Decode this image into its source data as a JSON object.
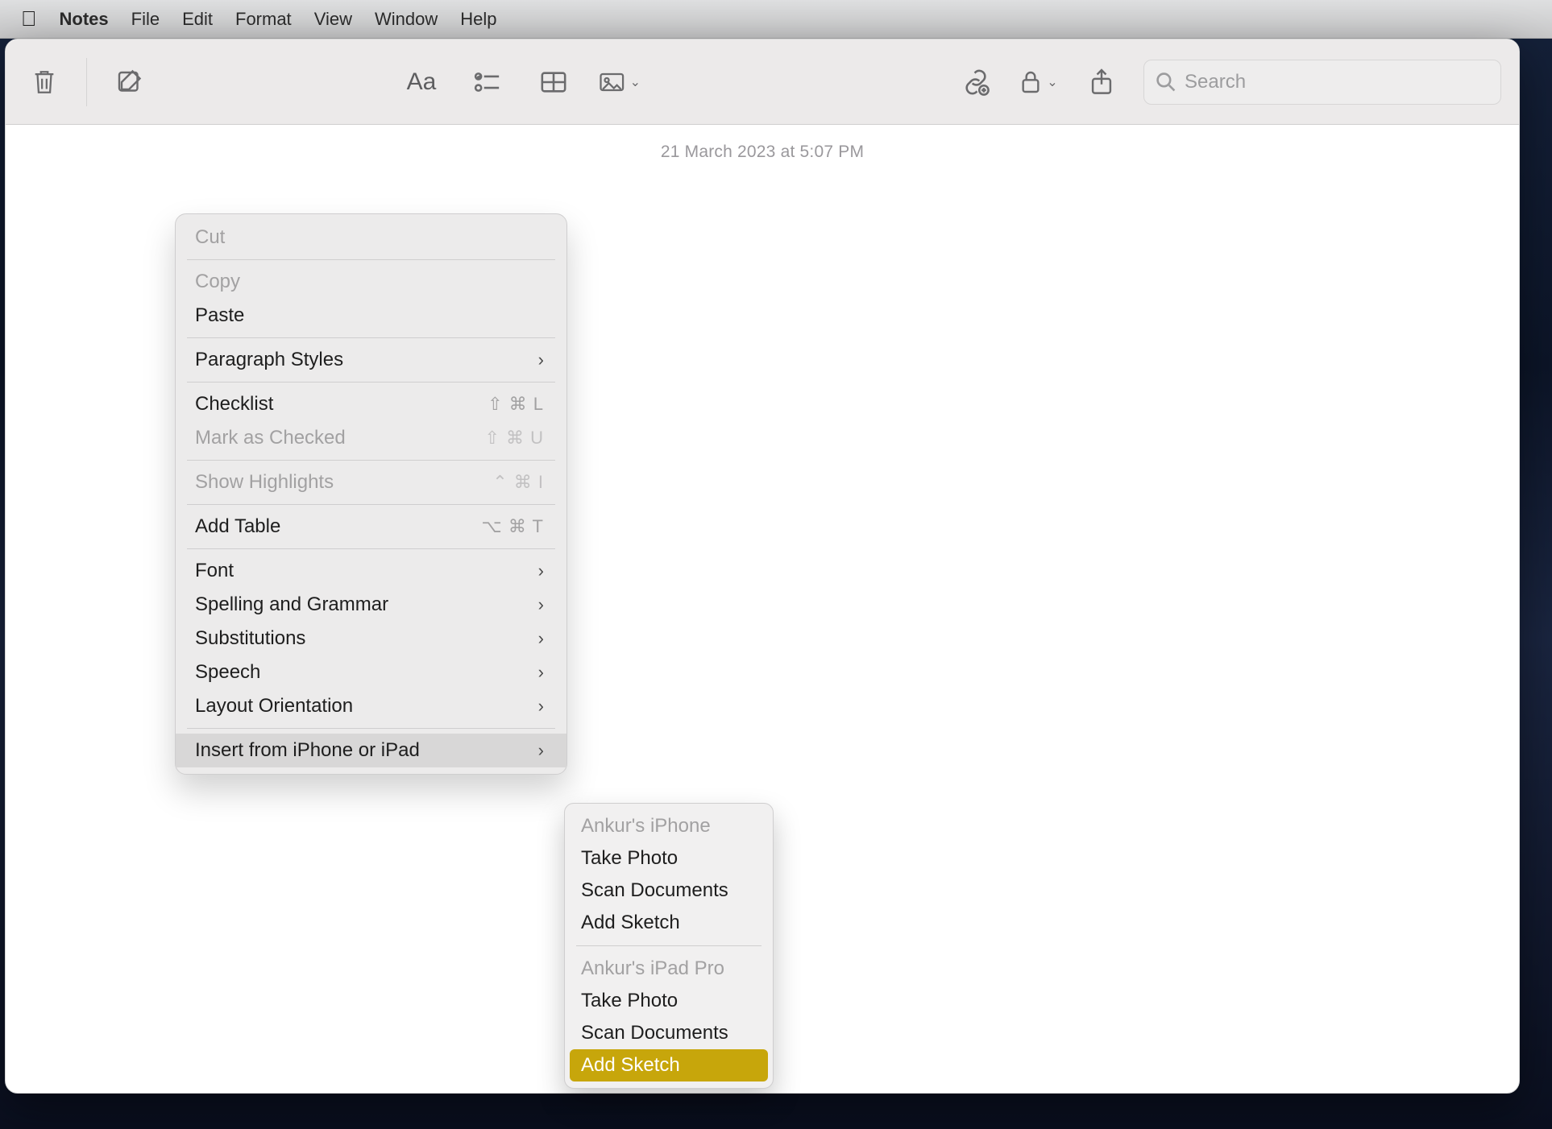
{
  "menubar": {
    "app": "Notes",
    "items": [
      "File",
      "Edit",
      "Format",
      "View",
      "Window",
      "Help"
    ]
  },
  "toolbar": {
    "search_placeholder": "Search"
  },
  "note": {
    "timestamp": "21 March 2023 at 5:07 PM"
  },
  "context_menu": {
    "cut": "Cut",
    "copy": "Copy",
    "paste": "Paste",
    "paragraph_styles": "Paragraph Styles",
    "checklist": {
      "label": "Checklist",
      "shortcut": "⇧ ⌘ L"
    },
    "mark_as_checked": {
      "label": "Mark as Checked",
      "shortcut": "⇧ ⌘ U"
    },
    "show_highlights": {
      "label": "Show Highlights",
      "shortcut": "⌃ ⌘ I"
    },
    "add_table": {
      "label": "Add Table",
      "shortcut": "⌥ ⌘ T"
    },
    "font": "Font",
    "spelling": "Spelling and Grammar",
    "substitutions": "Substitutions",
    "speech": "Speech",
    "layout_orientation": "Layout Orientation",
    "insert_from": "Insert from iPhone or iPad"
  },
  "submenu": {
    "device1_header": "Ankur's iPhone",
    "d1_take_photo": "Take Photo",
    "d1_scan_docs": "Scan Documents",
    "d1_add_sketch": "Add Sketch",
    "device2_header": "Ankur's iPad Pro",
    "d2_take_photo": "Take Photo",
    "d2_scan_docs": "Scan Documents",
    "d2_add_sketch": "Add Sketch"
  }
}
